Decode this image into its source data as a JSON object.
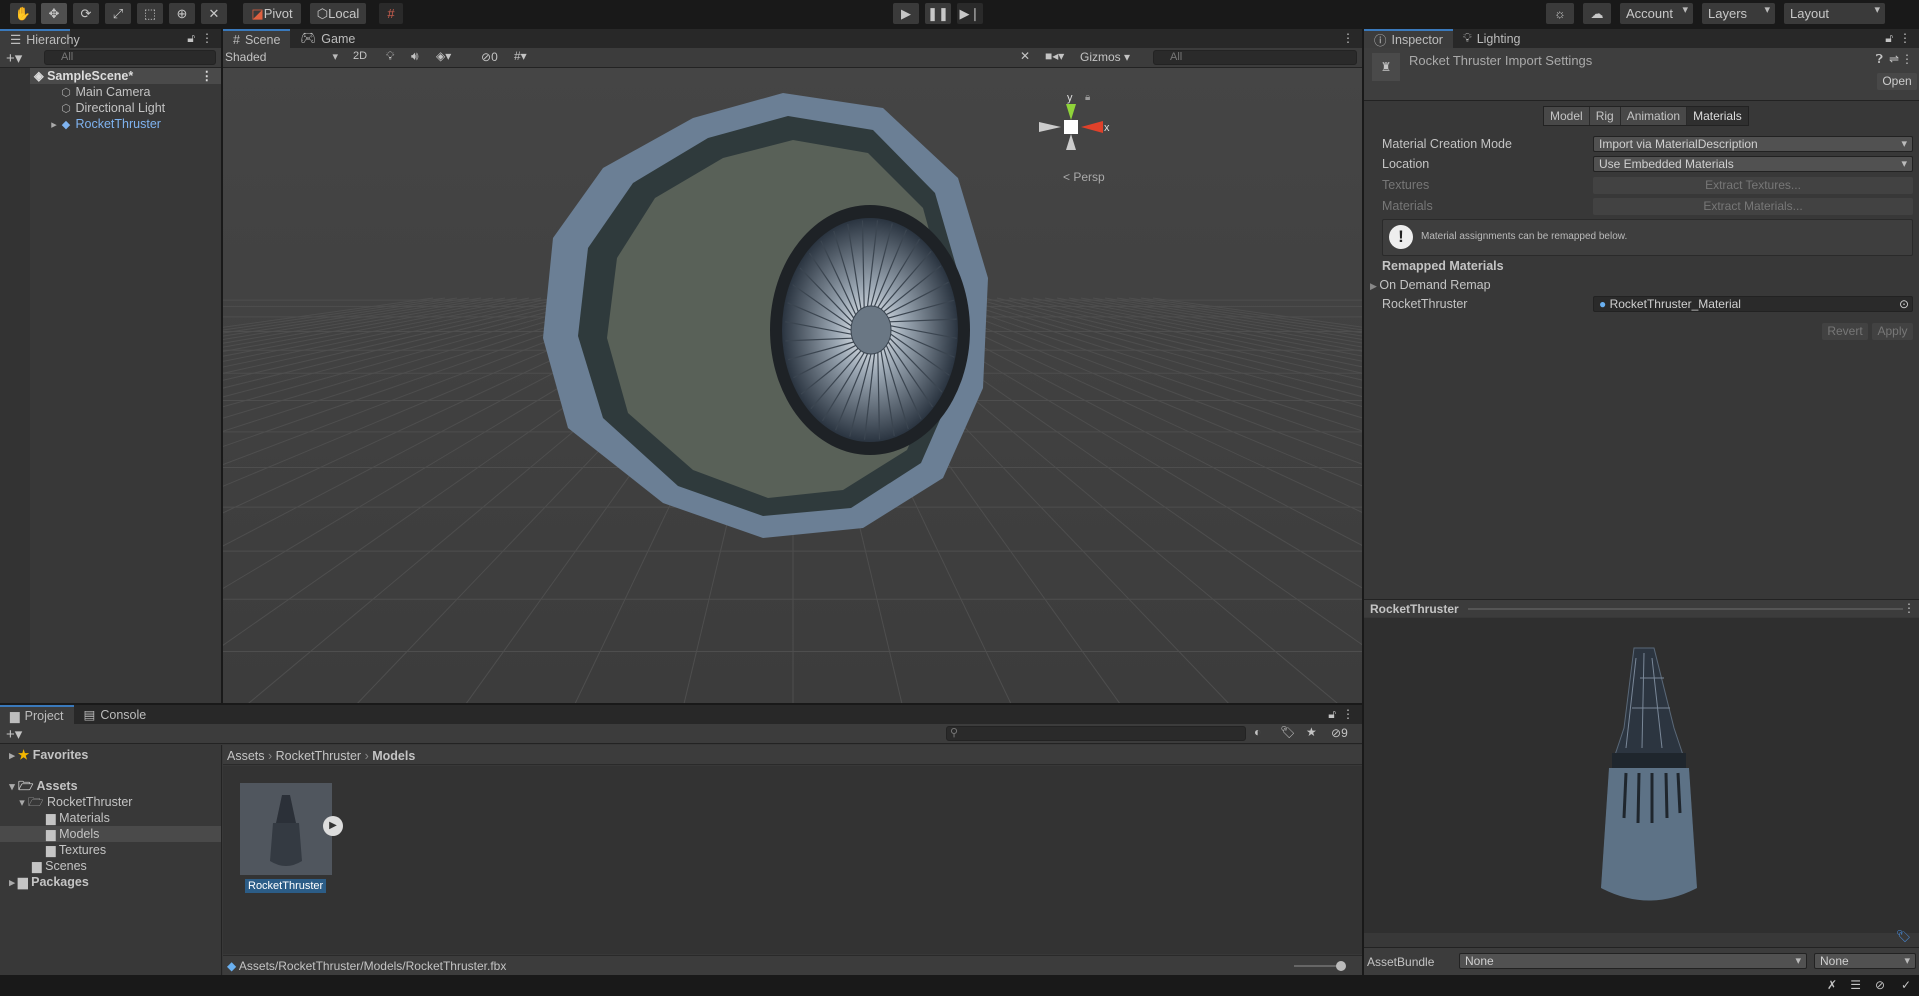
{
  "toolbar": {
    "tools": [
      "hand-tool",
      "move-tool",
      "rotate-tool",
      "scale-tool",
      "rect-tool",
      "transform-tool",
      "custom-tool"
    ],
    "pivot": "Pivot",
    "local": "Local",
    "account": "Account",
    "layers": "Layers",
    "layout": "Layout"
  },
  "hierarchy": {
    "tab": "Hierarchy",
    "search_placeholder": "All",
    "scene": "SampleScene*",
    "items": [
      "Main Camera",
      "Directional Light",
      "RocketThruster"
    ]
  },
  "scene": {
    "tabs": [
      "Scene",
      "Game"
    ],
    "shading": "Shaded",
    "mode2d": "2D",
    "hidden_count": "0",
    "gizmos": "Gizmos",
    "search_placeholder": "All",
    "projection": "Persp",
    "axis_y": "y",
    "axis_x": "x",
    "accent": "#3a79bb"
  },
  "inspector": {
    "tabs": [
      "Inspector",
      "Lighting"
    ],
    "title": "Rocket Thruster Import Settings",
    "open": "Open",
    "subtabs": [
      "Model",
      "Rig",
      "Animation",
      "Materials"
    ],
    "active_subtab": "Materials",
    "fields": [
      {
        "label": "Material Creation Mode",
        "value": "Import via MaterialDescription"
      },
      {
        "label": "Location",
        "value": "Use Embedded Materials"
      }
    ],
    "textures_label": "Textures",
    "extract_textures": "Extract Textures...",
    "materials_label": "Materials",
    "extract_materials": "Extract Materials...",
    "info": "Material assignments can be remapped below.",
    "remapped_header": "Remapped Materials",
    "on_demand": "On Demand Remap",
    "remap_label": "RocketThruster",
    "remap_value": "RocketThruster_Material",
    "revert": "Revert",
    "apply": "Apply",
    "preview_title": "RocketThruster",
    "assetbundle_label": "AssetBundle",
    "assetbundle_value": "None",
    "assetbundle_variant": "None"
  },
  "project": {
    "tabs": [
      "Project",
      "Console"
    ],
    "tree": {
      "favorites": "Favorites",
      "assets": "Assets",
      "rocket": "RocketThruster",
      "materials": "Materials",
      "models": "Models",
      "textures": "Textures",
      "scenes": "Scenes",
      "packages": "Packages"
    },
    "breadcrumb": [
      "Assets",
      "RocketThruster",
      "Models"
    ],
    "asset_name": "RocketThruster",
    "hidden_count": "9",
    "path": "Assets/RocketThruster/Models/RocketThruster.fbx"
  }
}
